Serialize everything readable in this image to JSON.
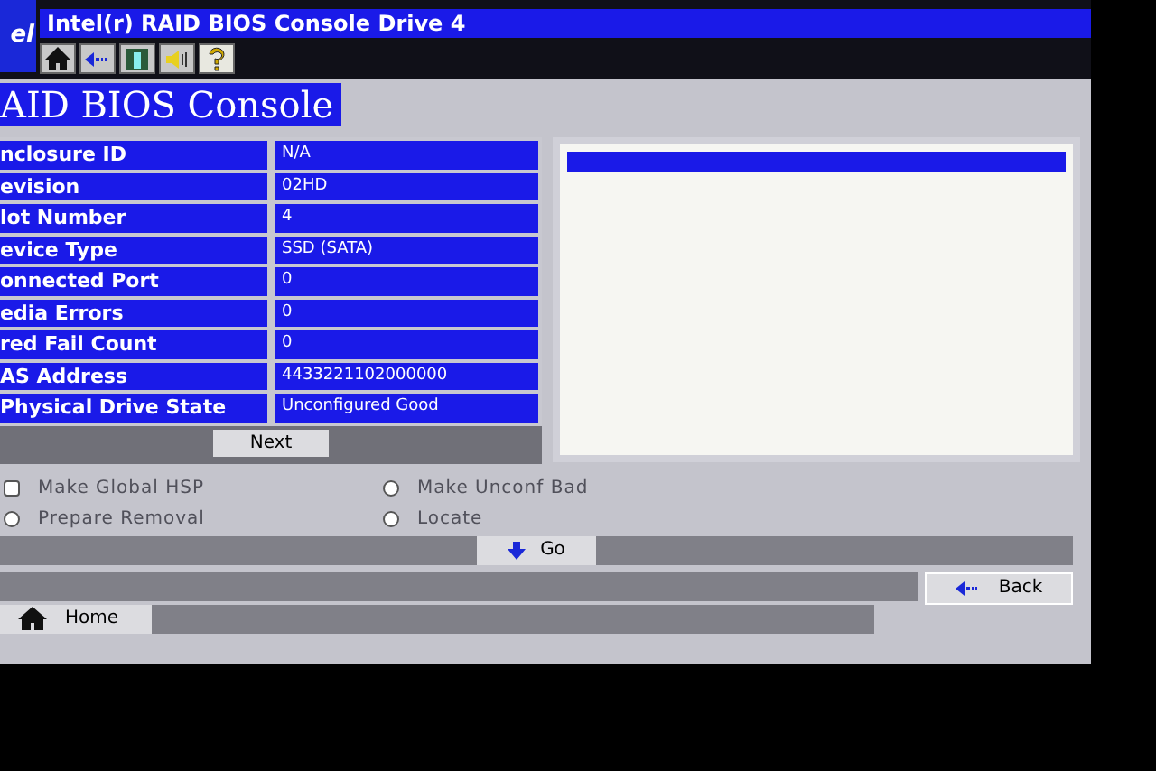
{
  "logo": {
    "text": "el"
  },
  "window": {
    "title": "Intel(r) RAID BIOS Console  Drive 4"
  },
  "toolbar": [
    {
      "kind": "home"
    },
    {
      "kind": "back"
    },
    {
      "kind": "exit"
    },
    {
      "kind": "sound"
    },
    {
      "kind": "help"
    }
  ],
  "page_title": "AID BIOS Console",
  "properties": [
    {
      "label": "nclosure ID",
      "value": "N/A"
    },
    {
      "label": "evision",
      "value": "02HD"
    },
    {
      "label": "lot Number",
      "value": "4"
    },
    {
      "label": "evice Type",
      "value": "SSD (SATA)"
    },
    {
      "label": "onnected Port",
      "value": "0"
    },
    {
      "label": "edia Errors",
      "value": "0"
    },
    {
      "label": "red Fail Count",
      "value": "0"
    },
    {
      "label": "AS Address",
      "value": "4433221102000000"
    },
    {
      "label": "Physical Drive State",
      "value": "Unconfigured Good"
    }
  ],
  "next_button": "Next",
  "list_panel": {
    "rows": [
      {
        "selected": true
      }
    ]
  },
  "options": [
    {
      "kind": "checkbox",
      "label": "Make Global HSP",
      "selected": false
    },
    {
      "kind": "radio",
      "label": "Make Unconf Bad",
      "selected": false
    },
    {
      "kind": "radio",
      "label": "Prepare Removal",
      "selected": false
    },
    {
      "kind": "radio",
      "label": "Locate",
      "selected": false
    }
  ],
  "go_button": "Go",
  "back_button": "Back",
  "home_button": "Home"
}
